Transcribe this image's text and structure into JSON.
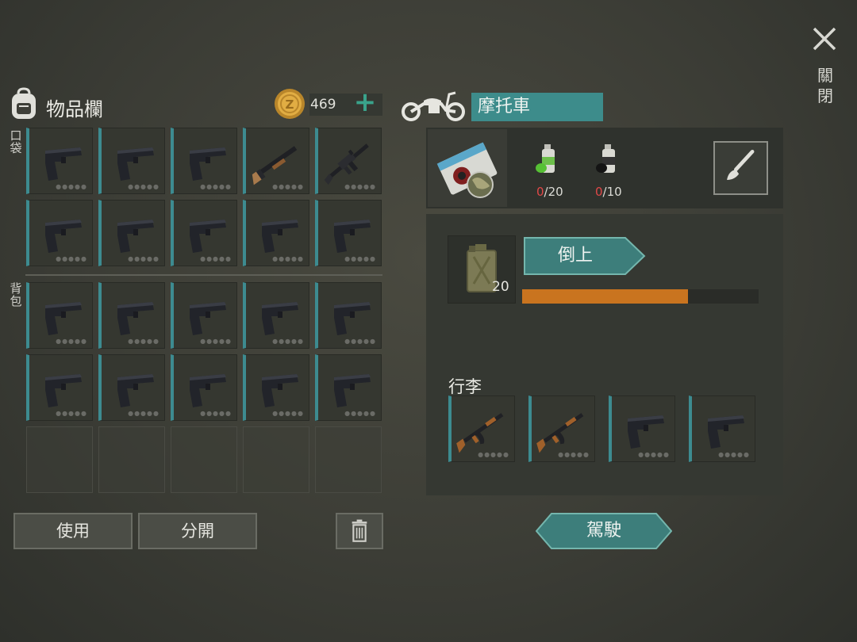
{
  "close": {
    "label": "關閉"
  },
  "inventory": {
    "title": "物品欄",
    "coins": "469",
    "add_label": "+",
    "pocket_label": "口袋",
    "backpack_label": "背包",
    "pocket_slots": [
      "pistol",
      "pistol",
      "pistol",
      "shotgun",
      "rifle",
      "pistol",
      "pistol",
      "pistol",
      "pistol",
      "pistol"
    ],
    "backpack_slots": [
      "pistol",
      "pistol",
      "pistol",
      "pistol",
      "pistol",
      "pistol",
      "pistol",
      "pistol",
      "pistol",
      "pistol",
      "empty",
      "empty",
      "empty",
      "empty",
      "empty"
    ],
    "use_button": "使用",
    "split_button": "分開"
  },
  "vehicle": {
    "name": "摩托車",
    "paint": {
      "green_current": "0",
      "green_max": "/20",
      "black_current": "0",
      "black_max": "/10"
    },
    "fuel": {
      "count": "20",
      "pour_button": "倒上",
      "level": 0.7
    },
    "luggage_label": "行李",
    "luggage_slots": [
      "ak-rifle",
      "ak-rifle",
      "pistol",
      "pistol"
    ],
    "drive_button": "駕駛"
  },
  "colors": {
    "accent": "#3d8c8b",
    "fuel": "#c9741f",
    "coin": "#d9a33a",
    "warning": "#e04848"
  }
}
